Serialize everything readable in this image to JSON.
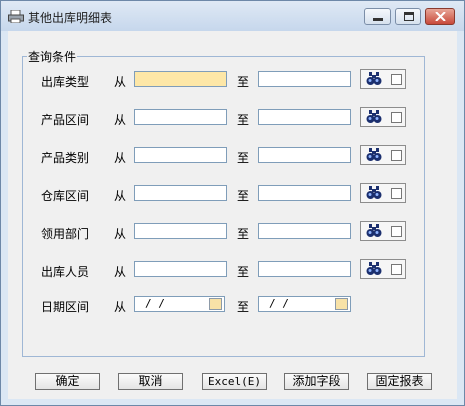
{
  "window": {
    "title": "其他出库明细表",
    "controls": {
      "minimize": "minimize",
      "maximize": "maximize",
      "close": "close"
    }
  },
  "query_group": {
    "title": "查询条件",
    "from_label": "从",
    "to_label": "至",
    "rows": [
      {
        "label": "出库类型",
        "from_value": "",
        "to_value": "",
        "has_browse": true
      },
      {
        "label": "产品区间",
        "from_value": "",
        "to_value": "",
        "has_browse": true
      },
      {
        "label": "产品类别",
        "from_value": "",
        "to_value": "",
        "has_browse": true
      },
      {
        "label": "仓库区间",
        "from_value": "",
        "to_value": "",
        "has_browse": true
      },
      {
        "label": "领用部门",
        "from_value": "",
        "to_value": "",
        "has_browse": true
      },
      {
        "label": "出库人员",
        "from_value": "",
        "to_value": "",
        "has_browse": true
      },
      {
        "label": "日期区间",
        "from_value": "/   /",
        "to_value": "/   /",
        "has_browse": false
      }
    ]
  },
  "buttons": {
    "ok": "确定",
    "cancel": "取消",
    "excel": "Excel(E)",
    "add_field": "添加字段",
    "fixed_report": "固定报表"
  },
  "colors": {
    "highlight_field": "#fde7a7",
    "close_button": "#c8493a",
    "title_bar": "#c6d7ec"
  },
  "icons": {
    "app": "printer-icon",
    "browse": "binoculars-icon",
    "calendar": "calendar-icon"
  }
}
